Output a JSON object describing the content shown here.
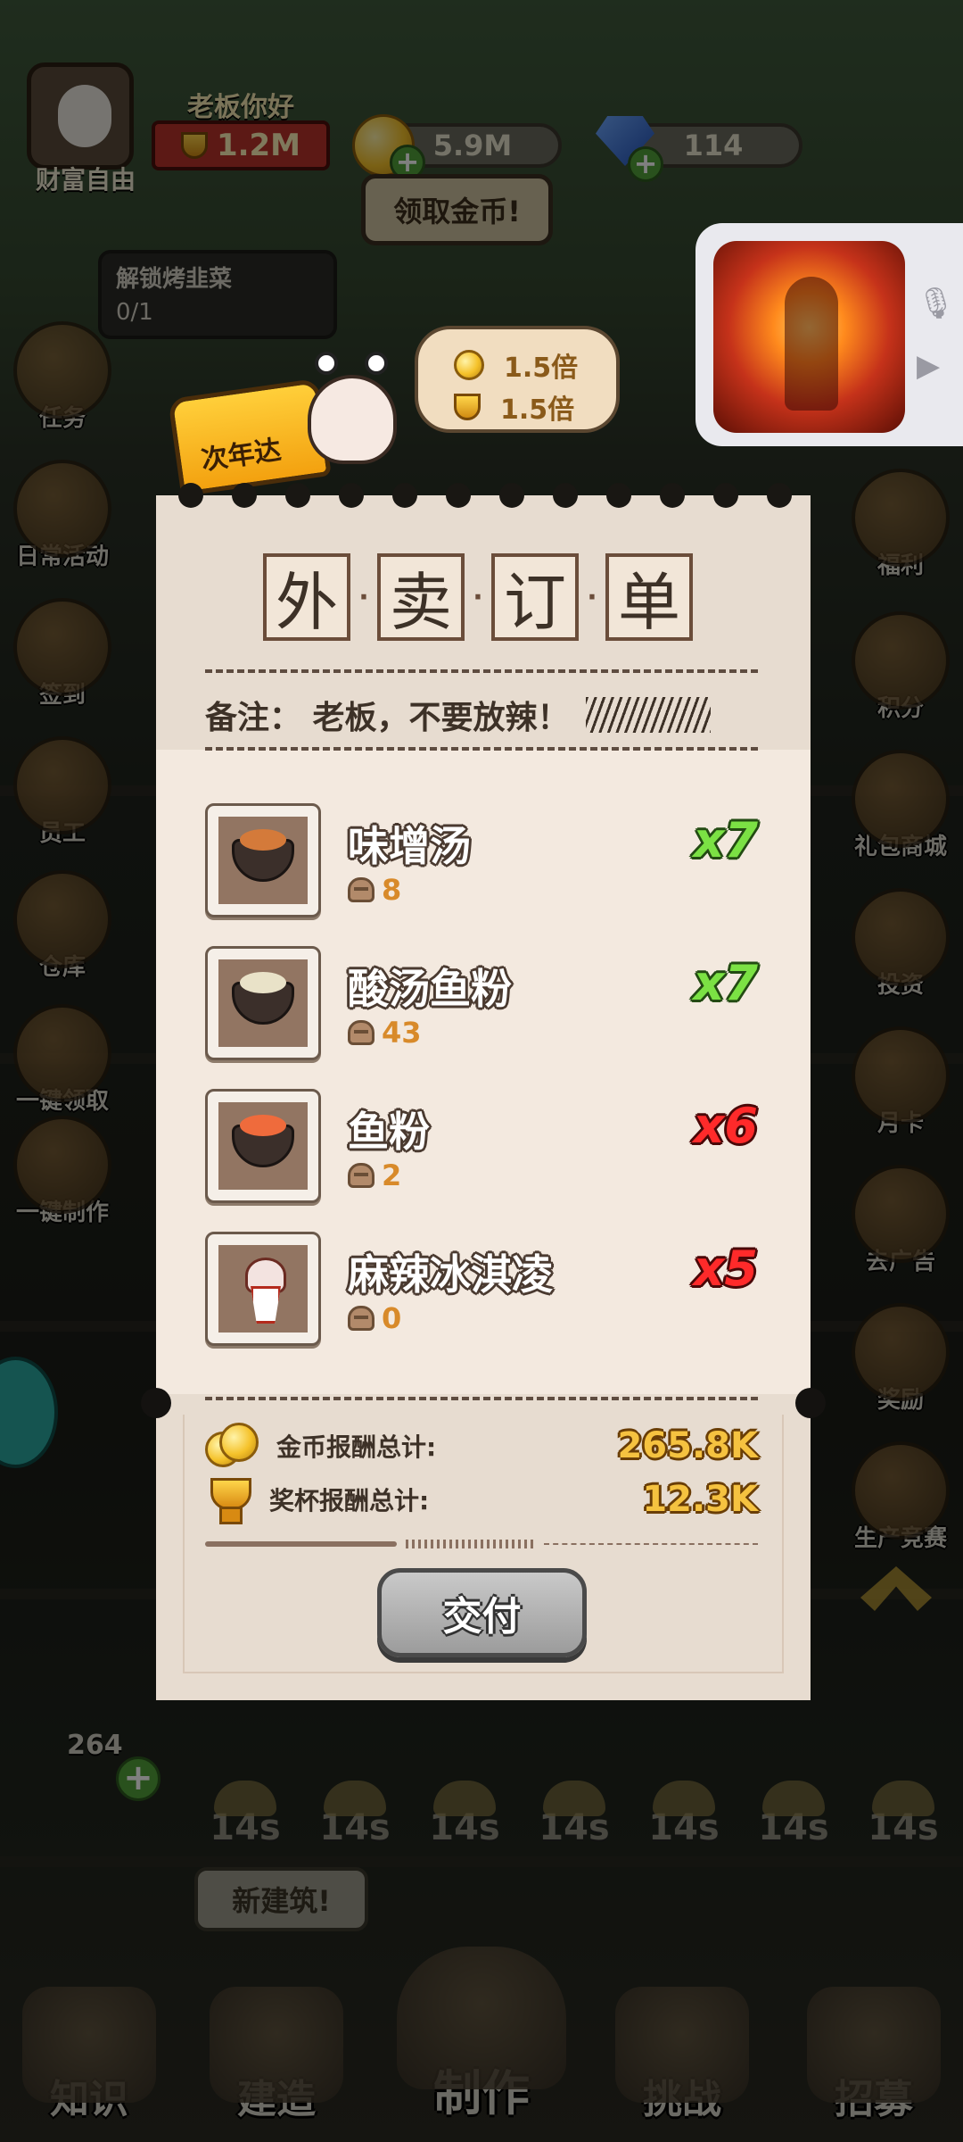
{
  "top_hud": {
    "player_title": "老板你好",
    "trophies": "1.2M",
    "avatar_label": "财富自由",
    "coins": "5.9M",
    "gems": "114",
    "claim_coins_label": "领取金币!",
    "quest_text": "解锁烤韭菜",
    "quest_progress": "0/1"
  },
  "left_menu": [
    {
      "label": "任务",
      "icon": "task-icon"
    },
    {
      "label": "日常活动",
      "icon": "daily-event-icon"
    },
    {
      "label": "签到",
      "icon": "calendar-icon"
    },
    {
      "label": "员工",
      "icon": "staff-icon"
    },
    {
      "label": "仓库",
      "icon": "warehouse-icon"
    },
    {
      "label": "一键领取",
      "icon": "hand-icon"
    },
    {
      "label": "一键制作",
      "icon": "chef-icon"
    }
  ],
  "right_menu": [
    {
      "label": "福利",
      "icon": "gift-icon"
    },
    {
      "label": "积分",
      "icon": "points-icon"
    },
    {
      "label": "礼包商城",
      "icon": "shop-icon"
    },
    {
      "label": "投资",
      "icon": "piggy-bank-icon"
    },
    {
      "label": "月卡",
      "icon": "card-icon"
    },
    {
      "label": "去广告",
      "icon": "no-ads-icon"
    },
    {
      "label": "奖励",
      "icon": "star-icon"
    },
    {
      "label": "生产竞赛",
      "icon": "contest-icon"
    }
  ],
  "delivery": {
    "badge_label": "次年达",
    "coin_bonus": "1.5倍",
    "trophy_bonus": "1.5倍"
  },
  "order": {
    "title_chars": [
      "外",
      "卖",
      "订",
      "单"
    ],
    "remark": "备注： 老板，不要放辣！",
    "items": [
      {
        "name": "味增汤",
        "stock": "8",
        "qty": "x7",
        "sufficient": true,
        "food_icon": "miso-soup-icon",
        "color": "#d47a3a"
      },
      {
        "name": "酸汤鱼粉",
        "stock": "43",
        "qty": "x7",
        "sufficient": true,
        "food_icon": "sour-fish-noodle-icon",
        "color": "#e9e2c8"
      },
      {
        "name": "鱼粉",
        "stock": "2",
        "qty": "x6",
        "sufficient": false,
        "food_icon": "fish-noodle-icon",
        "color": "#ef6b3c"
      },
      {
        "name": "麻辣冰淇凌",
        "stock": "0",
        "qty": "x5",
        "sufficient": false,
        "food_icon": "spicy-ice-cream-icon",
        "color": "#f3e3e0"
      }
    ],
    "coin_reward_label": "金币报酬总计:",
    "coin_reward": "265.8K",
    "trophy_reward_label": "奖杯报酬总计:",
    "trophy_reward": "12.3K",
    "deliver_label": "交付"
  },
  "production_timers": [
    "14s",
    "14s",
    "14s",
    "14s",
    "14s",
    "14s",
    "14s"
  ],
  "counter_badge": "264",
  "new_building_tip": "新建筑!",
  "bottom_nav": [
    {
      "label": "知识",
      "icon": "scroll-icon"
    },
    {
      "label": "建造",
      "icon": "hammer-icon"
    },
    {
      "label": "制作",
      "icon": "cooking-pot-icon"
    },
    {
      "label": "挑战",
      "icon": "swords-icon"
    },
    {
      "label": "招募",
      "icon": "recruit-card-icon"
    }
  ],
  "colors": {
    "qty_ok": "#7be144",
    "qty_short": "#ff2a2a",
    "reward_gold": "#f5c240",
    "paper": "#f3e9df"
  }
}
